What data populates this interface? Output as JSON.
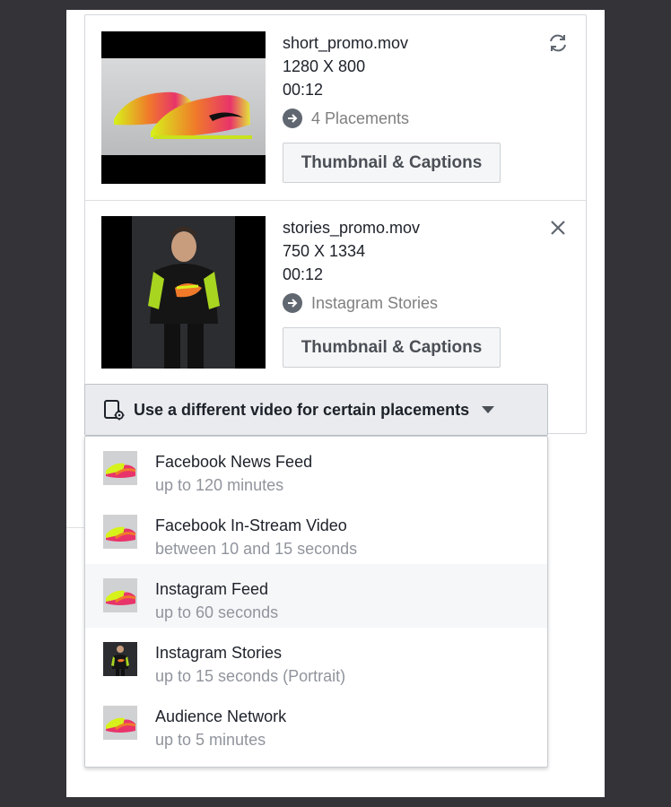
{
  "videos": [
    {
      "filename": "short_promo.mov",
      "dimensions": "1280 X 800",
      "duration": "00:12",
      "placement_text": "4 Placements",
      "button_label": "Thumbnail & Captions",
      "corner_icon": "refresh-icon"
    },
    {
      "filename": "stories_promo.mov",
      "dimensions": "750 X 1334",
      "duration": "00:12",
      "placement_text": "Instagram Stories",
      "button_label": "Thumbnail & Captions",
      "corner_icon": "close-icon"
    }
  ],
  "dropdown": {
    "label": "Use a different video for certain placements",
    "icon": "video-settings-icon"
  },
  "menu": {
    "items": [
      {
        "title": "Facebook News Feed",
        "subtitle": "up to 120 minutes",
        "thumb": "shoe"
      },
      {
        "title": "Facebook In-Stream Video",
        "subtitle": "between 10 and 15 seconds",
        "thumb": "shoe"
      },
      {
        "title": "Instagram Feed",
        "subtitle": "up to 60 seconds",
        "thumb": "shoe",
        "highlighted": true
      },
      {
        "title": "Instagram Stories",
        "subtitle": "up to 15 seconds (Portrait)",
        "thumb": "person"
      },
      {
        "title": "Audience Network",
        "subtitle": "up to 5 minutes",
        "thumb": "shoe"
      }
    ]
  },
  "colors": {
    "shoe_yellow": "#d7f21a",
    "shoe_orange": "#f07a2a",
    "shoe_pink": "#e8346a"
  }
}
